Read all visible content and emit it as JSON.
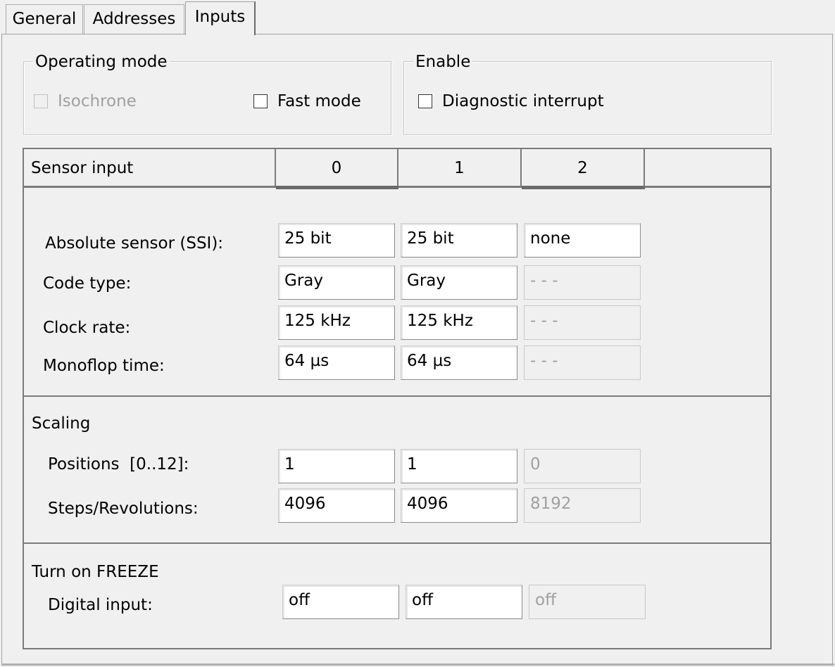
{
  "tabs": [
    {
      "label": "General"
    },
    {
      "label": "Addresses"
    },
    {
      "label": "Inputs"
    }
  ],
  "operating_mode": {
    "title": "Operating mode",
    "isochrone": "Isochrone",
    "fast_mode": "Fast mode"
  },
  "enable": {
    "title": "Enable",
    "diagnostic_interrupt": "Diagnostic interrupt"
  },
  "table": {
    "header": "Sensor input",
    "columns": [
      "0",
      "1",
      "2"
    ],
    "rows": [
      {
        "label": "Absolute sensor (SSI):",
        "values": [
          "25 bit",
          "25 bit",
          "none"
        ]
      },
      {
        "label": "Code type:",
        "values": [
          "Gray",
          "Gray",
          "- - -"
        ]
      },
      {
        "label": "Clock rate:",
        "values": [
          "125 kHz",
          "125 kHz",
          "- - -"
        ]
      },
      {
        "label": "Monoflop time:",
        "values": [
          "64 µs",
          "64 µs",
          "- - -"
        ]
      }
    ],
    "scaling": {
      "title": "Scaling",
      "rows": [
        {
          "label": "Positions  [0..12]:",
          "values": [
            "1",
            "1",
            "0"
          ]
        },
        {
          "label": "Steps/Revolutions:",
          "values": [
            "4096",
            "4096",
            "8192"
          ]
        }
      ]
    },
    "freeze": {
      "title": "Turn on FREEZE",
      "rows": [
        {
          "label": "Digital input:",
          "values": [
            "off",
            "off",
            "off"
          ]
        }
      ]
    }
  }
}
